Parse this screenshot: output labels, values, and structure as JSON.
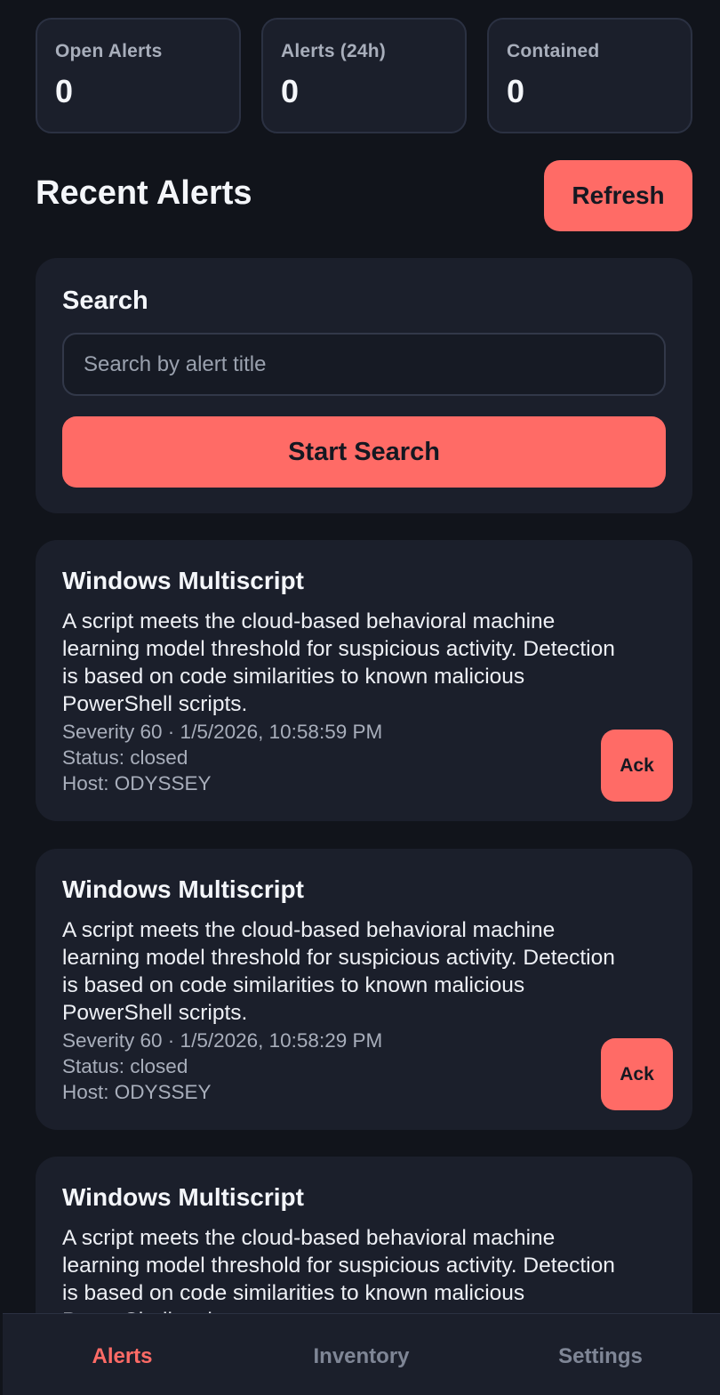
{
  "stats": [
    {
      "label": "Open Alerts",
      "value": "0"
    },
    {
      "label": "Alerts (24h)",
      "value": "0"
    },
    {
      "label": "Contained",
      "value": "0"
    }
  ],
  "section": {
    "title": "Recent Alerts",
    "refresh_label": "Refresh"
  },
  "search": {
    "label": "Search",
    "placeholder": "Search by alert title",
    "value": "",
    "button_label": "Start Search"
  },
  "alerts": [
    {
      "title": "Windows Multiscript",
      "description": "A script meets the cloud-based behavioral machine learning model threshold for suspicious activity. Detection is based on code similarities to known malicious PowerShell scripts.",
      "meta_line": "Severity 60 · 1/5/2026, 10:58:59 PM",
      "status": "Status: closed",
      "host": "Host: ODYSSEY",
      "ack_label": "Ack"
    },
    {
      "title": "Windows Multiscript",
      "description": "A script meets the cloud-based behavioral machine learning model threshold for suspicious activity. Detection is based on code similarities to known malicious PowerShell scripts.",
      "meta_line": "Severity 60 · 1/5/2026, 10:58:29 PM",
      "status": "Status: closed",
      "host": "Host: ODYSSEY",
      "ack_label": "Ack"
    },
    {
      "title": "Windows Multiscript",
      "description": "A script meets the cloud-based behavioral machine learning model threshold for suspicious activity. Detection is based on code similarities to known malicious PowerShell scripts."
    }
  ],
  "tabs": [
    {
      "label": "Alerts",
      "active": true
    },
    {
      "label": "Inventory",
      "active": false
    },
    {
      "label": "Settings",
      "active": false
    }
  ],
  "colors": {
    "accent": "#ff6b66",
    "background": "#11141b",
    "card": "#1b1f2b",
    "muted_text": "#a8aebb"
  }
}
